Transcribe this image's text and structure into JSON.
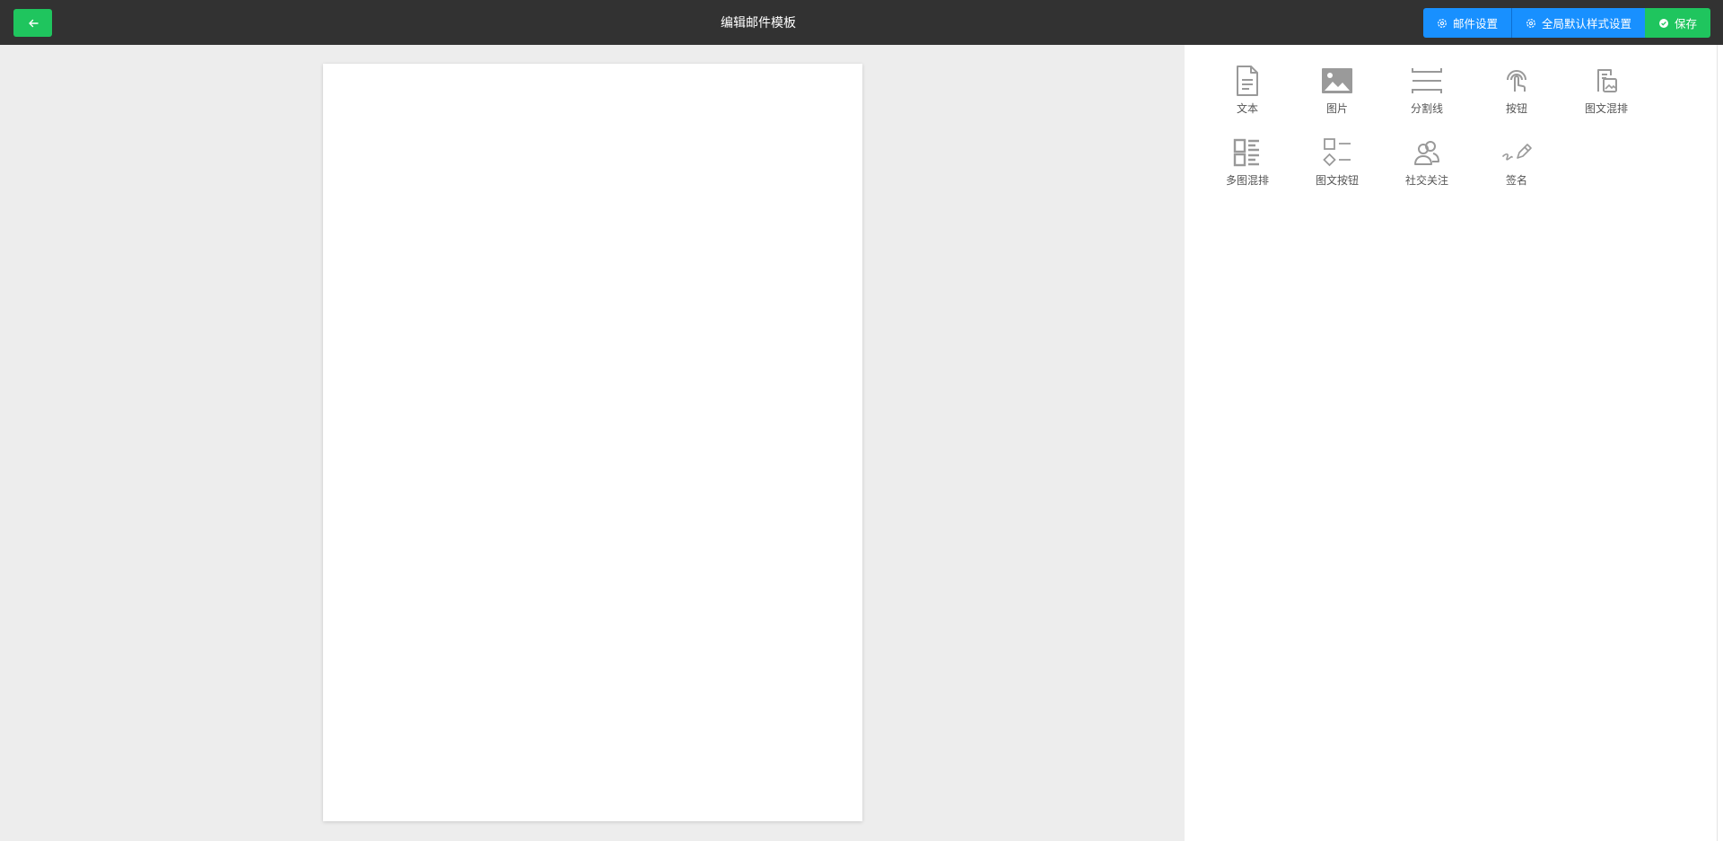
{
  "header": {
    "title": "编辑邮件模板",
    "back_icon": "arrow-left-icon",
    "buttons": {
      "mail_settings": "邮件设置",
      "global_style": "全局默认样式设置",
      "save": "保存"
    }
  },
  "components": [
    {
      "label": "文本",
      "icon": "text-document-icon"
    },
    {
      "label": "图片",
      "icon": "image-icon"
    },
    {
      "label": "分割线",
      "icon": "divider-icon"
    },
    {
      "label": "按钮",
      "icon": "tap-button-icon"
    },
    {
      "label": "图文混排",
      "icon": "image-text-mix-icon"
    },
    {
      "label": "多图混排",
      "icon": "multi-image-mix-icon"
    },
    {
      "label": "图文按钮",
      "icon": "image-text-button-icon"
    },
    {
      "label": "社交关注",
      "icon": "social-follow-icon"
    },
    {
      "label": "签名",
      "icon": "signature-icon"
    }
  ],
  "colors": {
    "topbar": "#323232",
    "primary_blue": "#1890ff",
    "success_green": "#1fc55e",
    "canvas_bg": "#ededed",
    "icon_gray": "#999999"
  }
}
